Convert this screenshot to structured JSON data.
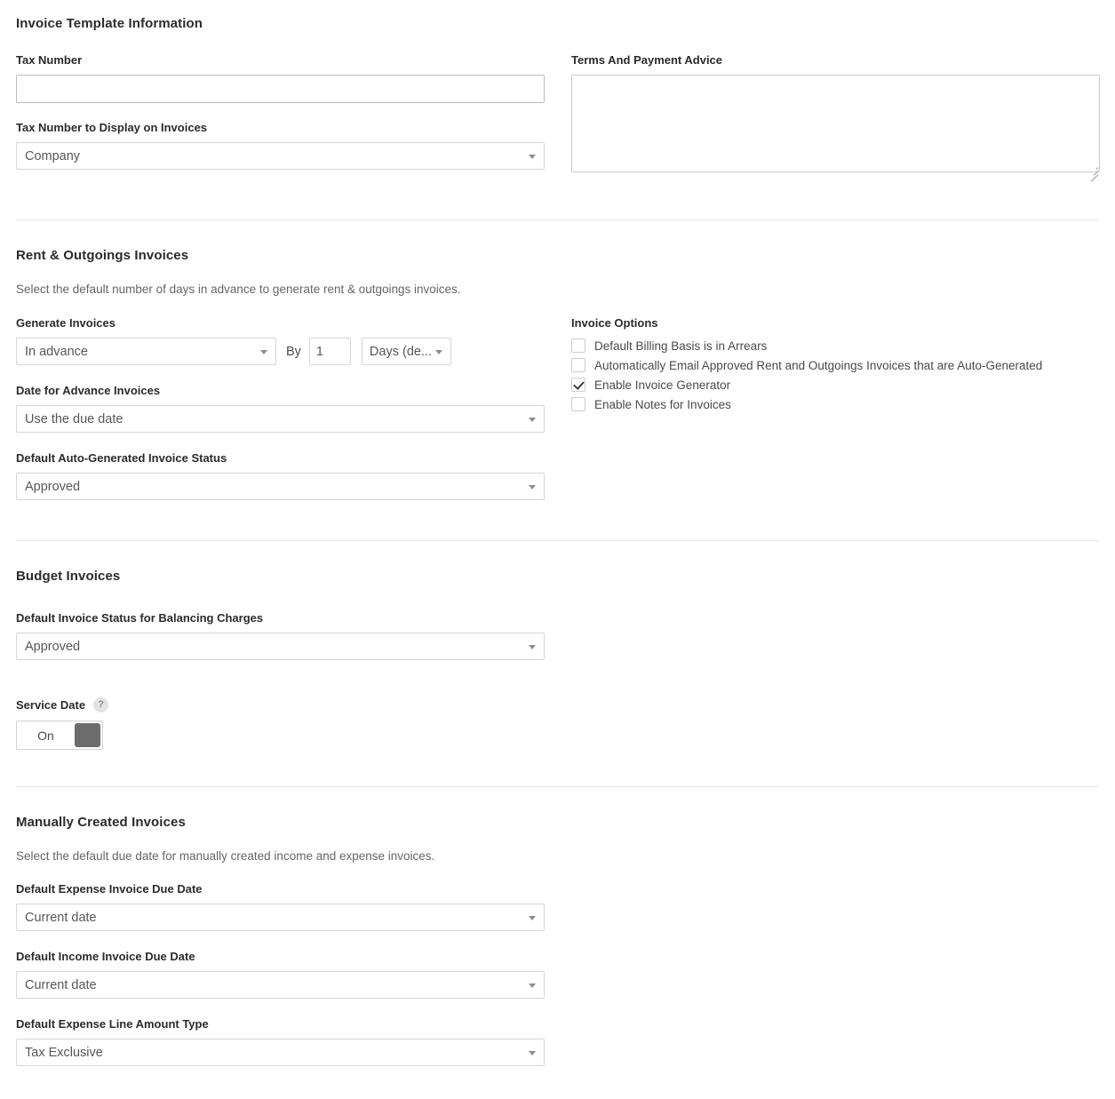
{
  "sections": {
    "template_info": {
      "title": "Invoice Template Information",
      "tax_number": {
        "label": "Tax Number",
        "value": "",
        "placeholder": ""
      },
      "tax_number_display": {
        "label": "Tax Number to Display on Invoices",
        "value": "Company"
      },
      "terms": {
        "label": "Terms And Payment Advice",
        "value": "",
        "placeholder": ""
      }
    },
    "rent_outgoings": {
      "title": "Rent & Outgoings Invoices",
      "description": "Select the default number of days in advance to generate rent & outgoings invoices.",
      "generate_invoices": {
        "label": "Generate Invoices",
        "value": "In advance",
        "by_label": "By",
        "by_value": "1",
        "unit_value": "Days (de..."
      },
      "date_for_advance": {
        "label": "Date for Advance Invoices",
        "value": "Use the due date"
      },
      "default_status": {
        "label": "Default Auto-Generated Invoice Status",
        "value": "Approved"
      },
      "invoice_options": {
        "title": "Invoice Options",
        "items": [
          {
            "label": "Default Billing Basis is in Arrears",
            "checked": false
          },
          {
            "label": "Automatically Email Approved Rent and Outgoings Invoices that are Auto-Generated",
            "checked": false
          },
          {
            "label": "Enable Invoice Generator",
            "checked": true
          },
          {
            "label": "Enable Notes for Invoices",
            "checked": false
          }
        ]
      }
    },
    "budget_invoices": {
      "title": "Budget Invoices",
      "balancing_charges": {
        "label": "Default Invoice Status for Balancing Charges",
        "value": "Approved"
      },
      "service_date": {
        "label": "Service Date",
        "help_icon": "question-mark-icon",
        "toggle_state": "On"
      }
    },
    "manual_invoices": {
      "title": "Manually Created Invoices",
      "description": "Select the default due date for manually created income and expense invoices.",
      "expense_due_date": {
        "label": "Default Expense Invoice Due Date",
        "value": "Current date"
      },
      "income_due_date": {
        "label": "Default Income Invoice Due Date",
        "value": "Current date"
      },
      "expense_line_type": {
        "label": "Default Expense Line Amount Type",
        "value": "Tax Exclusive"
      }
    }
  },
  "colors": {
    "text": "#333333",
    "muted": "#666666",
    "border": "#d6d6d6",
    "divider": "#e6e6e8",
    "toggle_knob": "#6d6d6d"
  }
}
